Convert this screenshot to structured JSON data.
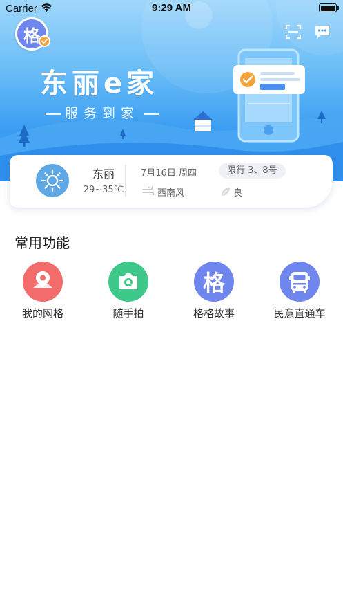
{
  "status_bar": {
    "carrier": "Carrier",
    "time": "9:29 AM"
  },
  "header": {
    "avatar_char": "格",
    "brand_title": "东丽e家",
    "brand_subtitle": "服务到家",
    "phone_badge_text": "服务到家"
  },
  "weather": {
    "city": "东丽",
    "temperature": "29~35℃",
    "date": "7月16日  周四",
    "traffic_limit": "限行 3、8号",
    "wind": "西南风",
    "air_quality": "良"
  },
  "functions": {
    "title": "常用功能",
    "items": [
      {
        "label": "我的网格",
        "icon": "map-pin-icon",
        "color": "#f26c6c"
      },
      {
        "label": "随手拍",
        "icon": "camera-icon",
        "color": "#3ec98a"
      },
      {
        "label": "格格故事",
        "icon": "ge-char-icon",
        "glyph": "格",
        "color": "#6f86ee"
      },
      {
        "label": "民意直通车",
        "icon": "car-icon",
        "color": "#6f86ee"
      }
    ]
  }
}
